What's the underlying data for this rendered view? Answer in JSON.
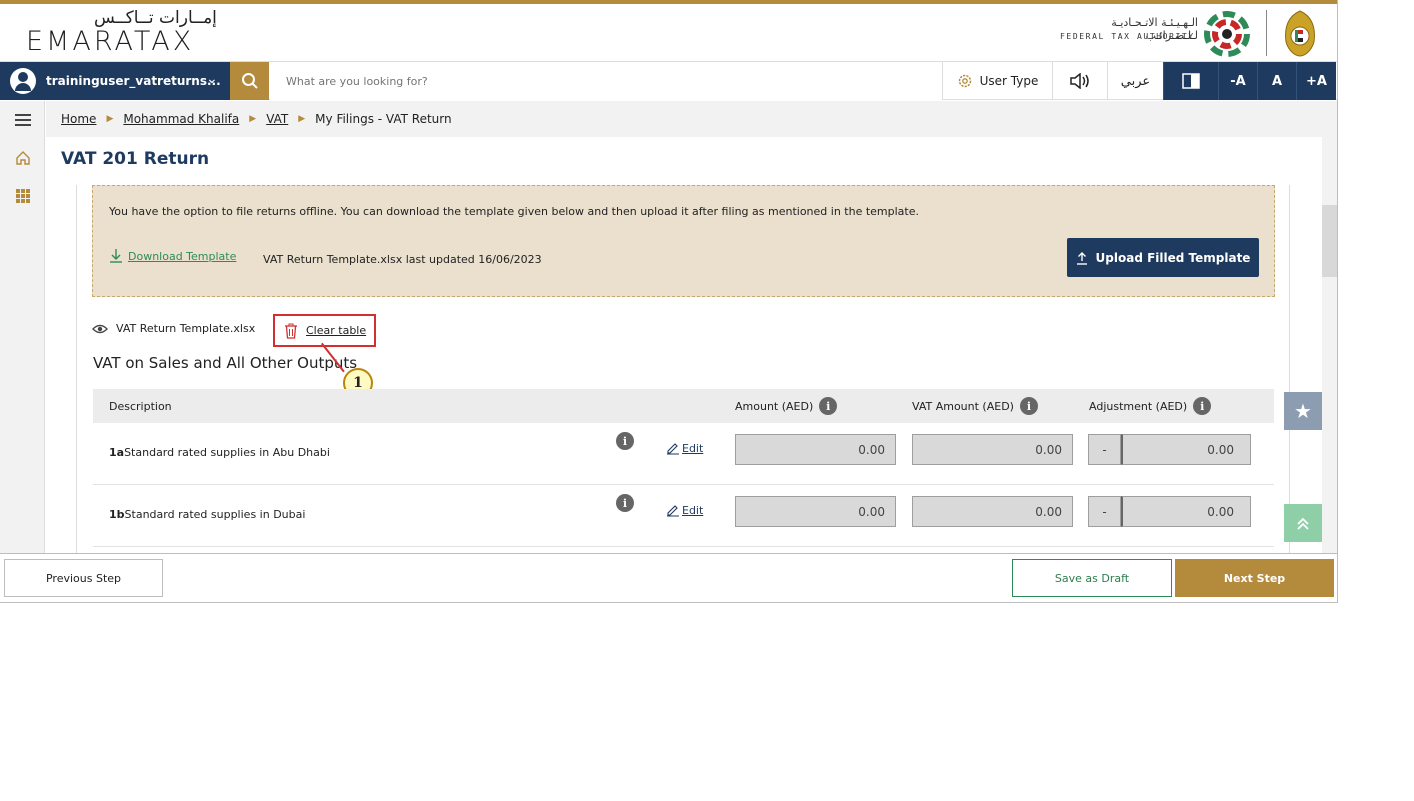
{
  "header": {
    "logo_arabic": "إمــارات تــاكــس",
    "logo_english": "EMARATAX",
    "authority_arabic": "الـهـيـئـة الاتـحـاديـة لـلـضـرائـب",
    "authority_english": "FEDERAL TAX AUTHORITY"
  },
  "navbar": {
    "username": "traininguser_vatreturns...",
    "search_placeholder": "What are you looking for?",
    "user_type_label": "User Type",
    "language_label": "عربي",
    "font_decrease": "-A",
    "font_default": "A",
    "font_increase": "+A"
  },
  "breadcrumb": {
    "items": [
      "Home",
      "Mohammad Khalifa",
      "VAT"
    ],
    "current": "My Filings - VAT Return"
  },
  "page": {
    "title": "VAT 201 Return"
  },
  "notice": {
    "text": "You have the option to file returns offline. You can download the template given below and then upload it after filing as mentioned in the template.",
    "download_label": "Download Template",
    "template_info": "VAT Return Template.xlsx last updated 16/06/2023",
    "upload_label": "Upload Filled Template"
  },
  "file": {
    "name": "VAT Return Template.xlsx",
    "clear_label": "Clear table"
  },
  "annotation": {
    "number": "1"
  },
  "section": {
    "title": "VAT on Sales and All Other Outputs"
  },
  "table": {
    "headers": {
      "description": "Description",
      "amount": "Amount (AED)",
      "vat_amount": "VAT Amount (AED)",
      "adjustment": "Adjustment (AED)"
    },
    "rows": [
      {
        "code": "1a",
        "description": "Standard rated supplies in Abu Dhabi",
        "edit": "Edit",
        "amount": "0.00",
        "vat_amount": "0.00",
        "adj_sign": "-",
        "adjustment": "0.00"
      },
      {
        "code": "1b",
        "description": "Standard rated supplies in Dubai",
        "edit": "Edit",
        "amount": "0.00",
        "vat_amount": "0.00",
        "adj_sign": "-",
        "adjustment": "0.00"
      }
    ]
  },
  "footer": {
    "previous_label": "Previous Step",
    "draft_label": "Save as Draft",
    "next_label": "Next Step"
  },
  "colors": {
    "brand_gold": "#b48a3c",
    "navy": "#1e3a5f",
    "notice_bg": "#eae0cd",
    "highlight_red": "#d32f2f",
    "green": "#2e8b57"
  },
  "icons": [
    "user-icon",
    "chevron-down-icon",
    "search-icon",
    "gear-icon",
    "speaker-icon",
    "contrast-icon",
    "menu-icon",
    "home-icon",
    "grid-icon",
    "download-icon",
    "upload-icon",
    "eye-icon",
    "trash-icon",
    "info-icon",
    "edit-icon",
    "star-icon",
    "scroll-top-icon"
  ]
}
